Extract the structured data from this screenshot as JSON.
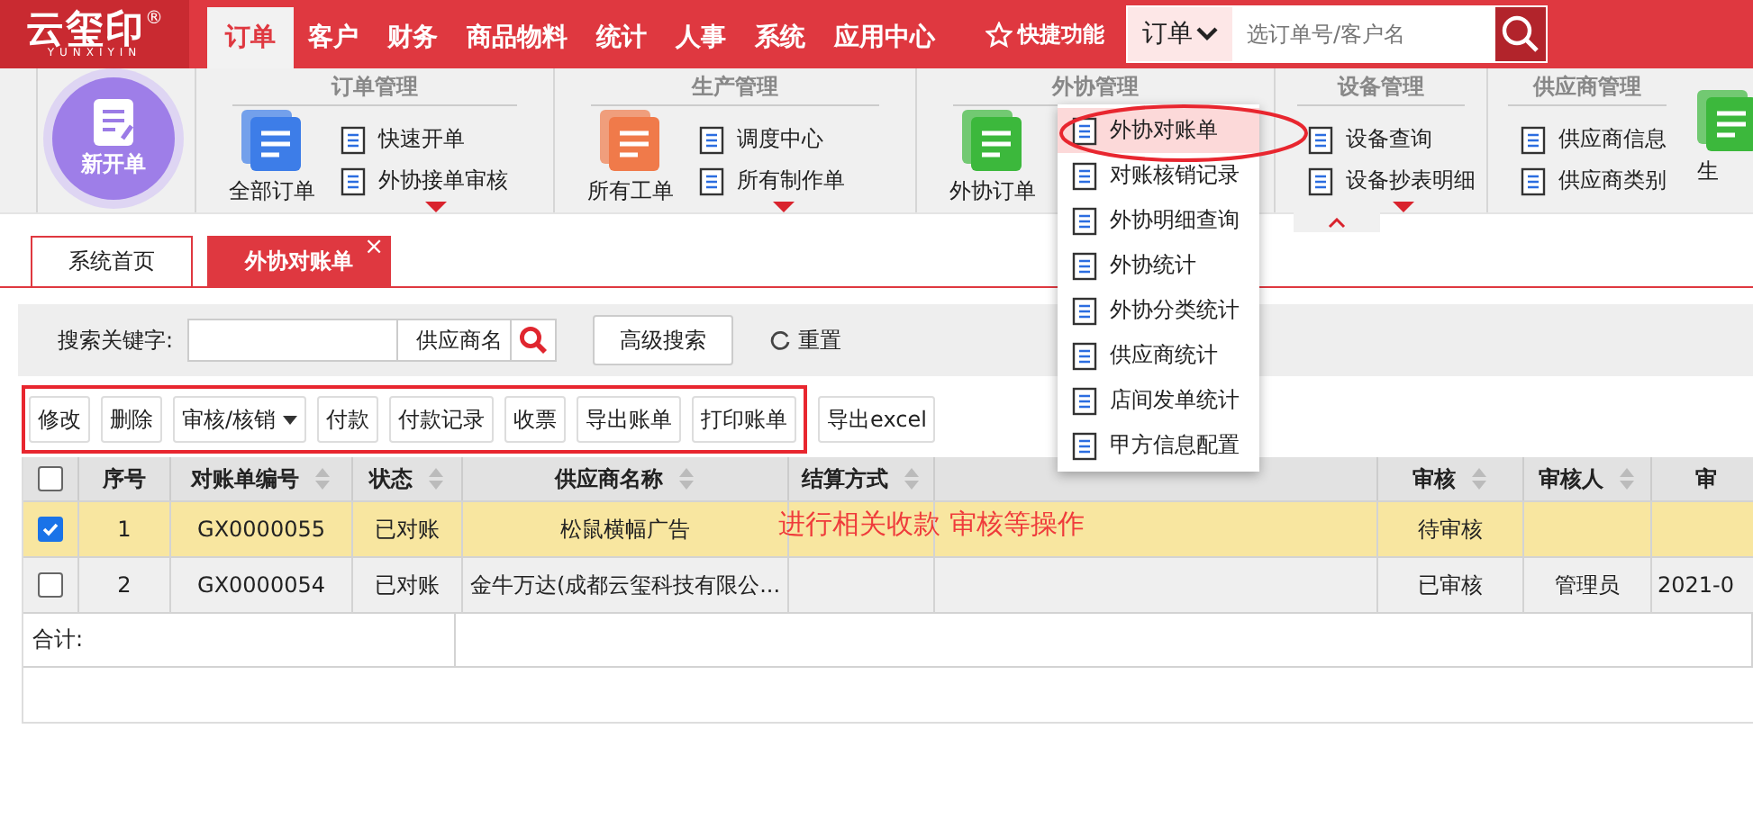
{
  "logo": {
    "text": "云玺印",
    "mark": "®",
    "subtitle": "YUNXIYIN"
  },
  "nav": [
    {
      "label": "订单",
      "selected": true
    },
    {
      "label": "客户",
      "selected": false
    },
    {
      "label": "财务",
      "selected": false
    },
    {
      "label": "商品物料",
      "selected": false
    },
    {
      "label": "统计",
      "selected": false
    },
    {
      "label": "人事",
      "selected": false
    },
    {
      "label": "系统",
      "selected": false
    },
    {
      "label": "应用中心",
      "selected": false
    }
  ],
  "quick": {
    "label": "快捷功能"
  },
  "search": {
    "scope": "订单",
    "placeholder": "选订单号/客户名"
  },
  "ribbon": [
    {
      "items": [
        {
          "kind": "round",
          "label": "新开单"
        }
      ]
    },
    {
      "title": "订单管理",
      "items": [
        {
          "kind": "big",
          "color": "#3d7de8",
          "label": "全部订单"
        },
        {
          "kind": "list",
          "links": [
            "快速开单",
            "外协接单审核"
          ],
          "more": true
        }
      ]
    },
    {
      "title": "生产管理",
      "items": [
        {
          "kind": "big",
          "color": "#f07a4a",
          "label": "所有工单"
        },
        {
          "kind": "list",
          "links": [
            "调度中心",
            "所有制作单"
          ],
          "more": true
        }
      ]
    },
    {
      "title": "外协管理",
      "items": [
        {
          "kind": "big",
          "color": "#3cb83c",
          "label": "外协订单"
        }
      ]
    },
    {
      "title": "设备管理",
      "items": [
        {
          "kind": "list",
          "links": [
            "设备查询",
            "设备抄表明细"
          ],
          "more": true
        }
      ]
    },
    {
      "title": "供应商管理",
      "items": [
        {
          "kind": "list",
          "links": [
            "供应商信息",
            "供应商类别"
          ]
        }
      ]
    },
    {
      "items": [
        {
          "kind": "big",
          "color": "#3cb83c",
          "label": "生"
        }
      ]
    }
  ],
  "menu": [
    {
      "label": "外协对账单",
      "selected": true
    },
    {
      "label": "对账核销记录",
      "selected": false
    },
    {
      "label": "外协明细查询",
      "selected": false
    },
    {
      "label": "外协统计",
      "selected": false
    },
    {
      "label": "外协分类统计",
      "selected": false
    },
    {
      "label": "供应商统计",
      "selected": false
    },
    {
      "label": "店间发单统计",
      "selected": false
    },
    {
      "label": "甲方信息配置",
      "selected": false
    }
  ],
  "tabs": [
    {
      "label": "系统首页",
      "selected": false,
      "closable": false
    },
    {
      "label": "外协对账单",
      "selected": true,
      "closable": true
    }
  ],
  "close_glyph": "×",
  "filter": {
    "label": "搜索关键字:",
    "field_type": "供应商名",
    "advanced": "高级搜索",
    "reset": "重置"
  },
  "toolbar": [
    {
      "label": "修改",
      "dropdown": false
    },
    {
      "label": "删除",
      "dropdown": false
    },
    {
      "label": "审核/核销",
      "dropdown": true
    },
    {
      "label": "付款",
      "dropdown": false
    },
    {
      "label": "付款记录",
      "dropdown": false
    },
    {
      "label": "收票",
      "dropdown": false
    },
    {
      "label": "导出账单",
      "dropdown": false
    },
    {
      "label": "打印账单",
      "dropdown": false
    },
    {
      "label": "导出excel",
      "dropdown": false
    }
  ],
  "annotation": {
    "text": "进行相关收款 审核等操作"
  },
  "table": {
    "select_all": {
      "checked": false
    },
    "columns": [
      {
        "label": "序号",
        "sortable": false
      },
      {
        "label": "对账单编号",
        "sortable": true
      },
      {
        "label": "状态",
        "sortable": true
      },
      {
        "label": "供应商名称",
        "sortable": true
      },
      {
        "label": "结算方式",
        "sortable": true
      },
      {
        "sortable": false
      },
      {
        "label": "审核",
        "sortable": true
      },
      {
        "label": "审核人",
        "sortable": true
      },
      {
        "label": "审",
        "sortable": false
      }
    ],
    "rows": [
      {
        "selected": true,
        "cells": [
          "1",
          "GX0000055",
          "已对账",
          "松鼠横幅广告",
          null,
          null,
          "待审核",
          null,
          null
        ]
      },
      {
        "selected": false,
        "cells": [
          "2",
          "GX0000054",
          "已对账",
          "金牛万达(成都云玺科技有限公...",
          null,
          null,
          "已审核",
          "管理员",
          "2021-0"
        ]
      }
    ],
    "total": "合计:"
  }
}
